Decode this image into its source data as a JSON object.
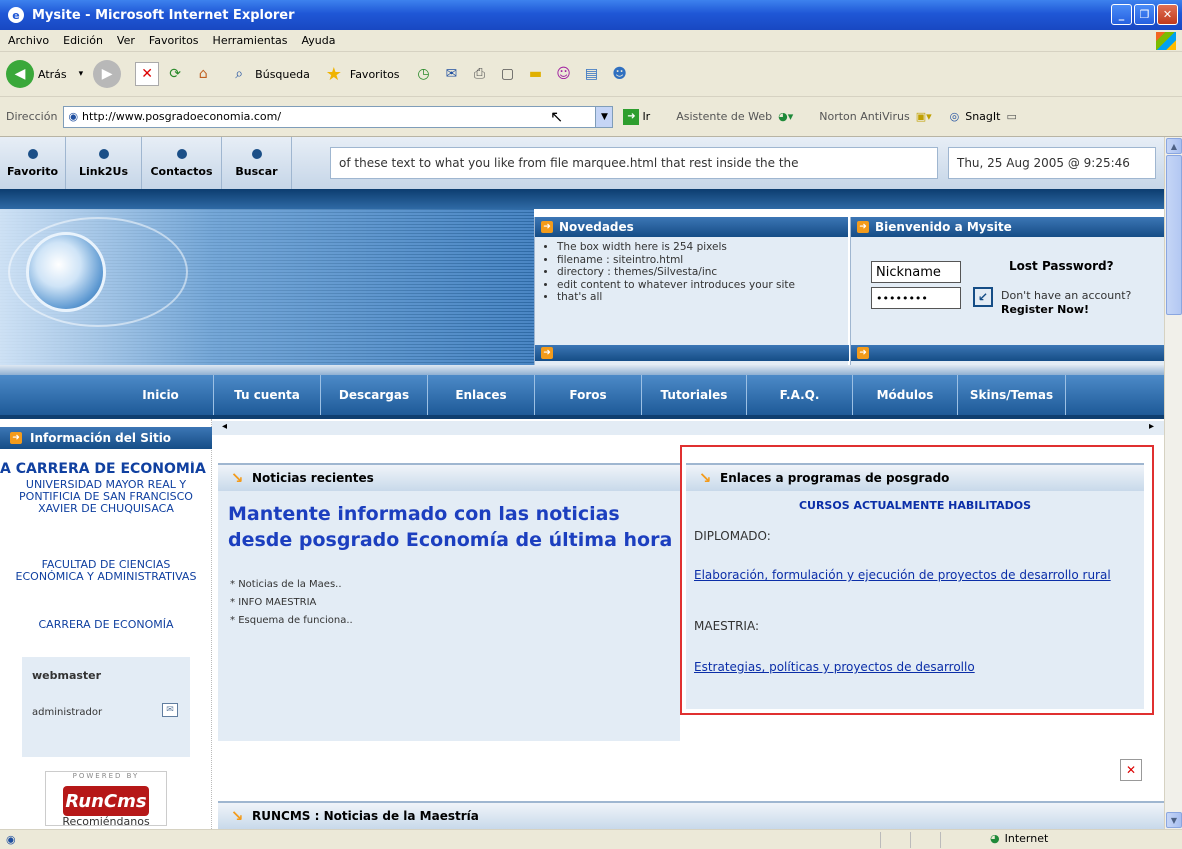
{
  "window": {
    "title": "Mysite - Microsoft Internet Explorer"
  },
  "menu": [
    "Archivo",
    "Edición",
    "Ver",
    "Favoritos",
    "Herramientas",
    "Ayuda"
  ],
  "toolbar": {
    "back": "Atrás",
    "search": "Búsqueda",
    "favorites": "Favoritos"
  },
  "address": {
    "label": "Dirección",
    "url": "http://www.posgradoeconomia.com/",
    "go": "Ir",
    "web_assistant": "Asistente de Web",
    "norton": "Norton AntiVirus",
    "snagit": "SnagIt"
  },
  "top_links": [
    "Favorito",
    "Link2Us",
    "Contactos",
    "Buscar"
  ],
  "marquee": "of these text to what you like from file marquee.html that rest inside the the",
  "clock": "Thu, 25 Aug 2005 @ 9:25:46",
  "novedades": {
    "title": "Novedades",
    "items": [
      "The box width here is 254 pixels",
      "filename : siteintro.html",
      "directory : themes/Silvesta/inc",
      "edit content to whatever introduces your site",
      "that's all"
    ]
  },
  "login": {
    "title": "Bienvenido a Mysite",
    "nickname_placeholder": "Nickname",
    "password_mask": "••••••••",
    "lost_password": "Lost Password?",
    "no_account": "Don't have an account?",
    "register": "Register Now!"
  },
  "nav": [
    "Inicio",
    "Tu cuenta",
    "Descargas",
    "Enlaces",
    "Foros",
    "Tutoriales",
    "F.A.Q.",
    "Módulos",
    "Skins/Temas"
  ],
  "left": {
    "header": "Información del Sitio",
    "big": "A CARRERA DE ECONOMÍA",
    "university": "UNIVERSIDAD MAYOR REAL Y PONTIFICIA DE SAN FRANCISCO XAVIER DE CHUQUISACA",
    "faculty": "FACULTAD DE CIENCIAS ECONÓMICA Y ADMINISTRATIVAS",
    "career": "CARRERA DE ECONOMÍA",
    "webmaster": "webmaster",
    "admin": "administrador",
    "powered": "POWERED BY",
    "runcms": "RunCms",
    "recommend": "Recomiéndanos"
  },
  "news": {
    "header": "Noticias recientes",
    "title": "Mantente informado con las noticias desde posgrado Economía de última hora",
    "items": [
      "Noticias de la Maes..",
      "INFO MAESTRIA",
      "Esquema de funciona.."
    ]
  },
  "links": {
    "header": "Enlaces a programas de posgrado",
    "courses": "CURSOS ACTUALMENTE HABILITADOS",
    "diplomado": "DIPLOMADO:",
    "diplomado_link": "Elaboración, formulación y ejecución de proyectos de desarrollo rural",
    "maestria": "MAESTRIA:",
    "maestria_link": "Estrategias, políticas y proyectos de desarrollo"
  },
  "runcms_news": {
    "header": "RUNCMS : Noticias de la Maestría"
  },
  "status": {
    "zone": "Internet"
  }
}
